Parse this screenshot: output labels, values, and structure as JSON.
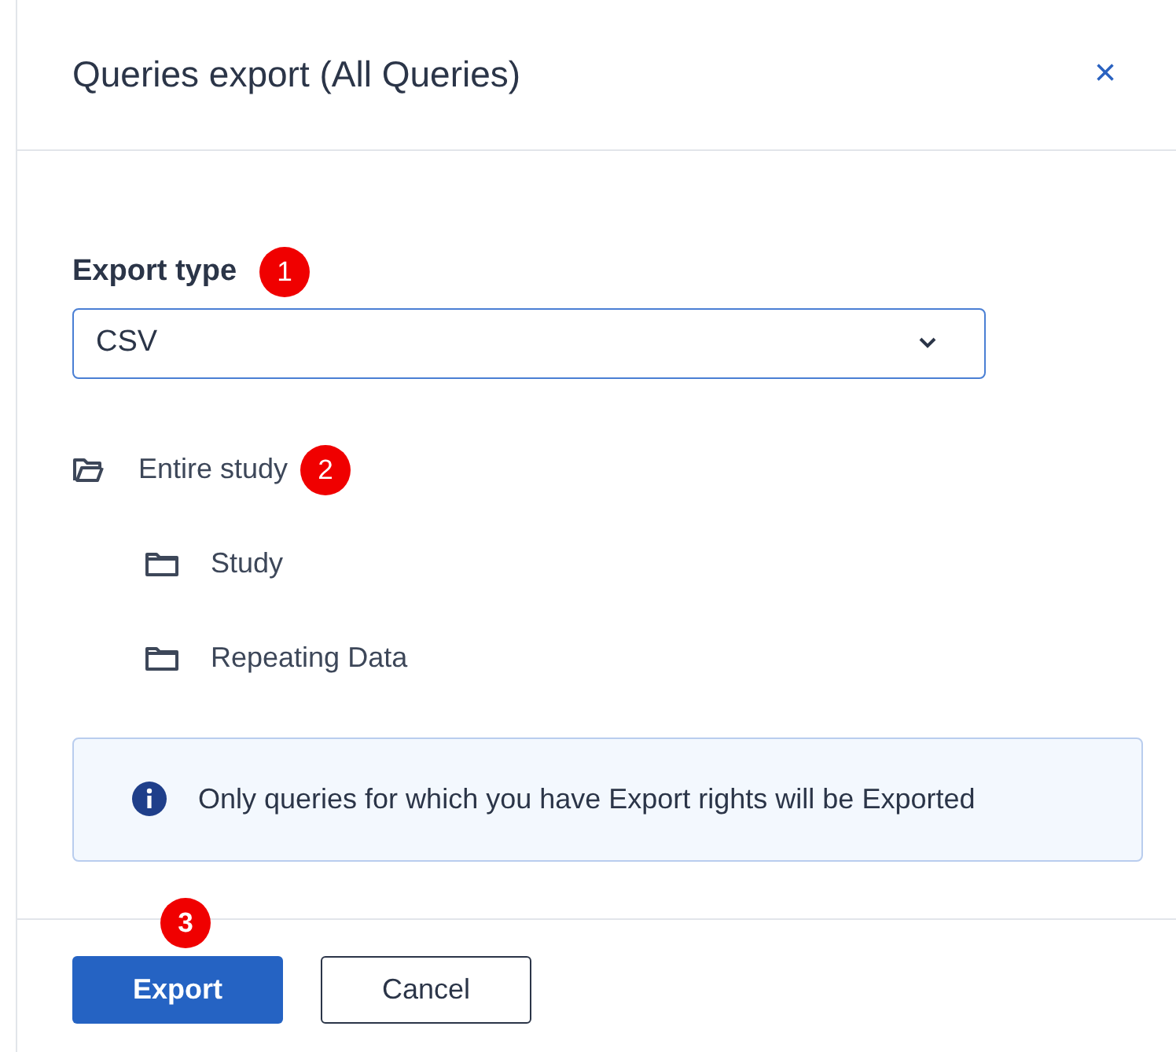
{
  "dialog": {
    "title": "Queries export (All Queries)",
    "close": "×"
  },
  "export_type": {
    "label": "Export type",
    "badge": "1",
    "value": "CSV"
  },
  "tree": [
    {
      "label": "Entire study",
      "badge": "2",
      "children": [
        {
          "label": "Study"
        },
        {
          "label": "Repeating Data"
        }
      ]
    }
  ],
  "info": "Only queries for which you have Export rights will be Exported",
  "buttons": [
    {
      "label": "Export",
      "kind": "primary",
      "badge": "3"
    },
    {
      "label": "Cancel",
      "kind": "secondary"
    }
  ]
}
